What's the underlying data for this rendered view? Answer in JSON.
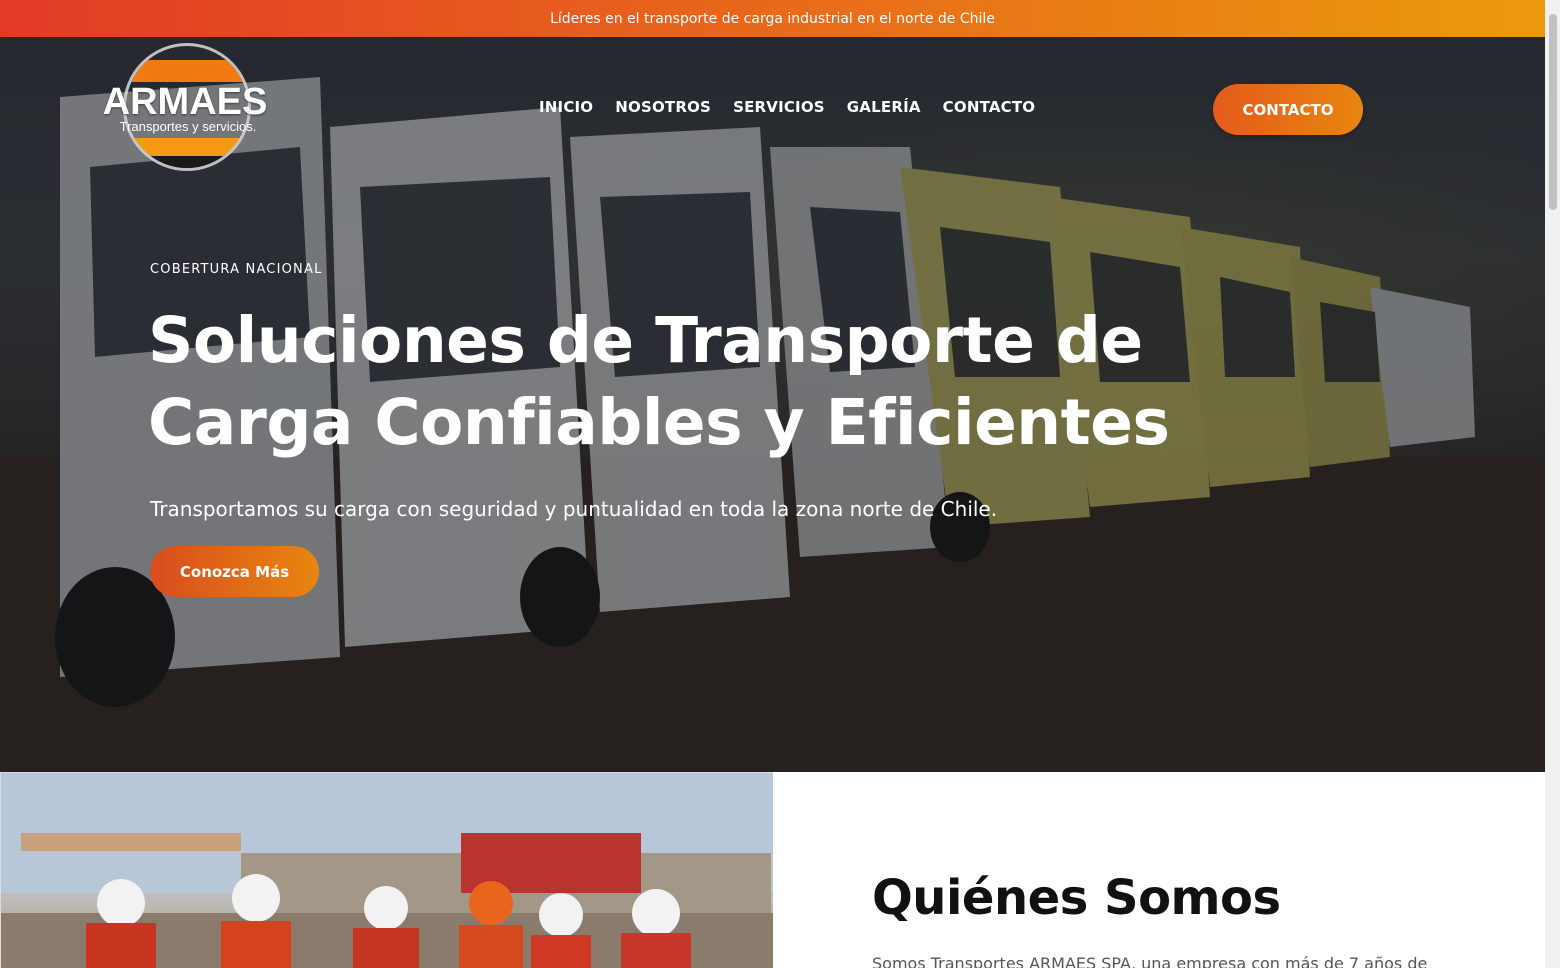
{
  "topbar": {
    "text": "Líderes en el transporte de carga industrial en el norte de Chile"
  },
  "logo": {
    "brand": "ARMAES",
    "tagline": "Transportes y servicios."
  },
  "nav": {
    "items": [
      "INICIO",
      "NOSOTROS",
      "SERVICIOS",
      "GALERÍA",
      "CONTACTO"
    ],
    "cta": "CONTACTO"
  },
  "hero": {
    "eyebrow": "COBERTURA NACIONAL",
    "headline_line1": "Soluciones de Transporte de",
    "headline_line2": "Carga Confiables y Eficientes",
    "subheadline": "Transportamos su carga con seguridad y puntualidad en toda la zona norte de Chile.",
    "button": "Conozca Más"
  },
  "about": {
    "title": "Quiénes Somos",
    "text": "Somos Transportes ARMAES SPA, una empresa con más de 7 años de"
  },
  "colors": {
    "accent_start": "#e23a26",
    "accent_end": "#eb9a0c"
  }
}
